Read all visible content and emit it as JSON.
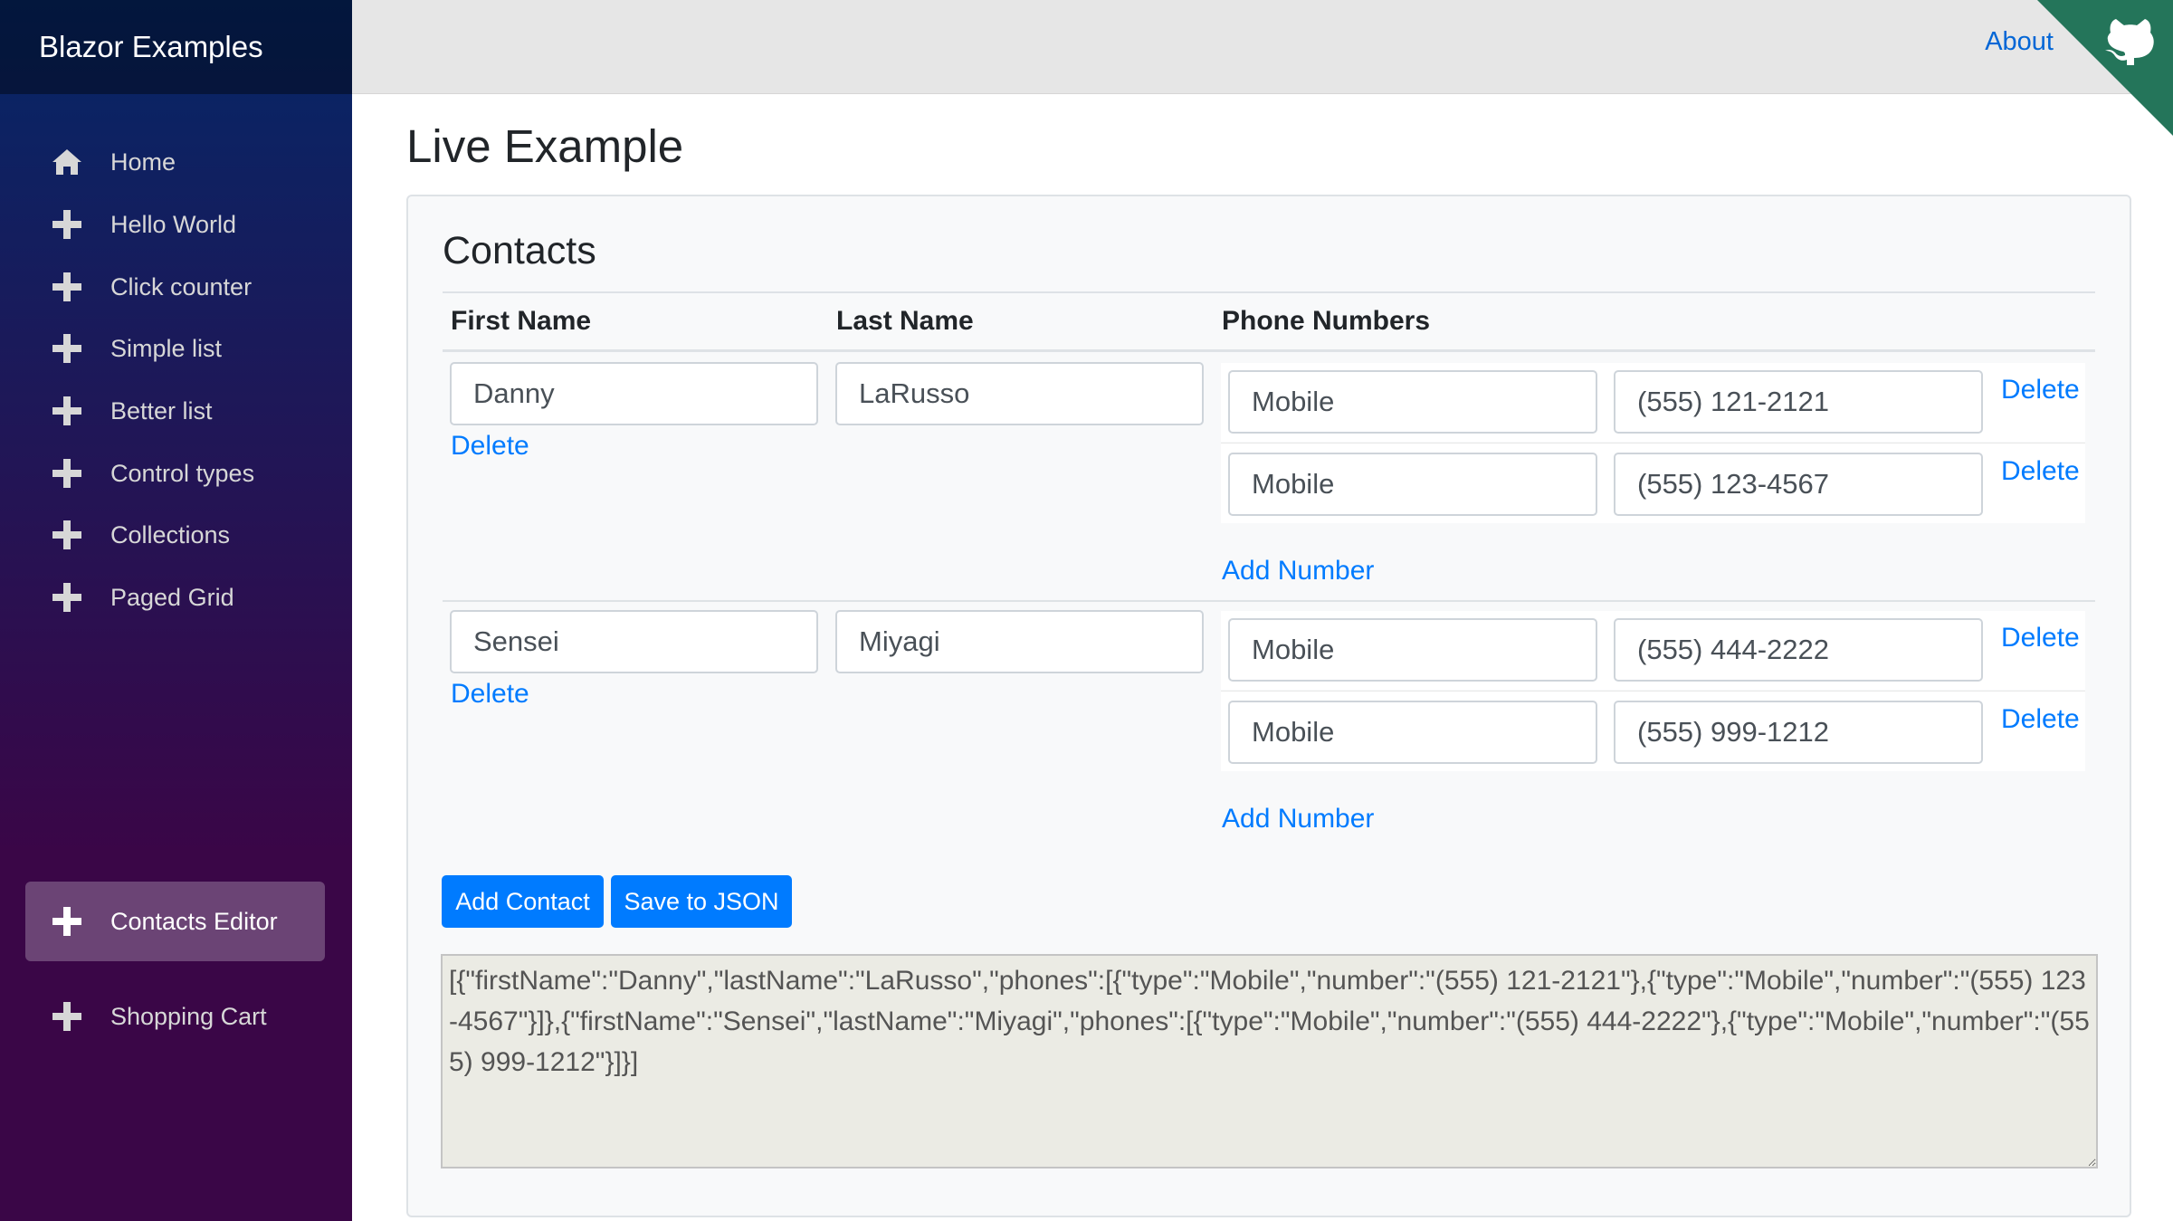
{
  "app": {
    "brand": "Blazor Examples"
  },
  "sidebar": {
    "items": [
      {
        "label": "Home",
        "icon": "home-icon"
      },
      {
        "label": "Hello World",
        "icon": "plus-icon"
      },
      {
        "label": "Click counter",
        "icon": "plus-icon"
      },
      {
        "label": "Simple list",
        "icon": "plus-icon"
      },
      {
        "label": "Better list",
        "icon": "plus-icon"
      },
      {
        "label": "Control types",
        "icon": "plus-icon"
      },
      {
        "label": "Collections",
        "icon": "plus-icon"
      },
      {
        "label": "Paged Grid",
        "icon": "plus-icon"
      },
      {
        "label": "Contacts Editor",
        "icon": "plus-icon",
        "active": true
      },
      {
        "label": "Shopping Cart",
        "icon": "plus-icon"
      }
    ]
  },
  "topbar": {
    "about": "About",
    "corner_icon": "github-octocat-icon"
  },
  "main": {
    "title": "Live Example",
    "card_title": "Contacts",
    "columns": {
      "first": "First Name",
      "last": "Last Name",
      "phones": "Phone Numbers"
    },
    "contacts": [
      {
        "first": "Danny",
        "last": "LaRusso",
        "delete": "Delete",
        "phones": [
          {
            "type": "Mobile",
            "number": "(555) 121-2121",
            "delete": "Delete"
          },
          {
            "type": "Mobile",
            "number": "(555) 123-4567",
            "delete": "Delete"
          }
        ],
        "add_number": "Add Number"
      },
      {
        "first": "Sensei",
        "last": "Miyagi",
        "delete": "Delete",
        "phones": [
          {
            "type": "Mobile",
            "number": "(555) 444-2222",
            "delete": "Delete"
          },
          {
            "type": "Mobile",
            "number": "(555) 999-1212",
            "delete": "Delete"
          }
        ],
        "add_number": "Add Number"
      }
    ],
    "buttons": {
      "add_contact": "Add Contact",
      "save_json": "Save to JSON"
    },
    "json_output": "[{\"firstName\":\"Danny\",\"lastName\":\"LaRusso\",\"phones\":[{\"type\":\"Mobile\",\"number\":\"(555) 121-2121\"},{\"type\":\"Mobile\",\"number\":\"(555) 123-4567\"}]},{\"firstName\":\"Sensei\",\"lastName\":\"Miyagi\",\"phones\":[{\"type\":\"Mobile\",\"number\":\"(555) 444-2222\"},{\"type\":\"Mobile\",\"number\":\"(555) 999-1212\"}]}]"
  },
  "colors": {
    "accent": "#007bff",
    "link": "#0366d6",
    "sidebar_top": "#052767",
    "sidebar_bottom": "#3a0647",
    "corner": "#24755a"
  }
}
